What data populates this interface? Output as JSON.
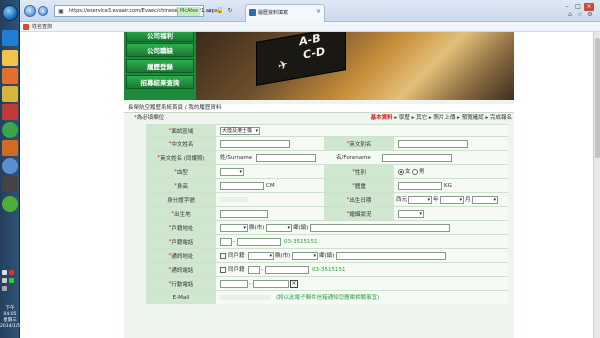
{
  "taskbar": {
    "clock_time": "下午 04:05",
    "clock_day": "星期三",
    "clock_date": "2014/1/5"
  },
  "browser": {
    "url": "https://eservice3.evaair.com/Evaec/chinese/Evaeo021.aspx",
    "cert_label": "McAfee",
    "tab_title": "履歷資料填寫",
    "bookmark": "姓名查詢"
  },
  "site": {
    "menu": [
      "公司福利",
      "公司職缺",
      "履歷登錄",
      "招募結果查詢"
    ],
    "banner_board": [
      "A-B",
      "C-D"
    ]
  },
  "breadcrumb": "長榮航空履歷系統首頁 / 我的履歷資料",
  "required_note": {
    "star": "*",
    "text": "為必填欄位"
  },
  "steps": [
    {
      "label": "基本資料",
      "active": true
    },
    {
      "label": "學歷"
    },
    {
      "label": "其它"
    },
    {
      "label": "照片上傳"
    },
    {
      "label": "預覽確認"
    },
    {
      "label": "完成報名"
    }
  ],
  "form": {
    "region_label": "面試區域",
    "region_value": "大陸及港士橿",
    "name_cn_label": "中文姓名",
    "name_en_label_star": "英文別名",
    "passport_name_label": "英文姓名 (同護照)",
    "surname_label": "姓/Surname",
    "forename_label": "名/Forename",
    "blood_label": "血型",
    "gender_label": "性別",
    "gender_options": [
      "女",
      "男"
    ],
    "height_label": "身高",
    "height_unit": "CM",
    "weight_label": "體重",
    "weight_unit": "KG",
    "id_label": "身分證字號",
    "birth_label": "出生日期",
    "birth_era": "西元",
    "birth_year": "年",
    "birth_month": "月",
    "birthplace_label": "出生地",
    "marital_label": "婚姻狀況",
    "reg_addr_label": "戶籍地址",
    "county": "縣(市)",
    "town": "鄉(鎮)",
    "reg_phone_label": "戶籍電話",
    "phone_example": "03-3515151",
    "mail_addr_label": "通訊地址",
    "same_as_reg": "同戶籍",
    "mail_phone_label": "通訊電話",
    "mobile_label": "行動電話",
    "mobile_x": "×",
    "email_label": "E-Mail",
    "email_note": "(將以此電子郵件信箱通知您應徵相關事宜)"
  }
}
